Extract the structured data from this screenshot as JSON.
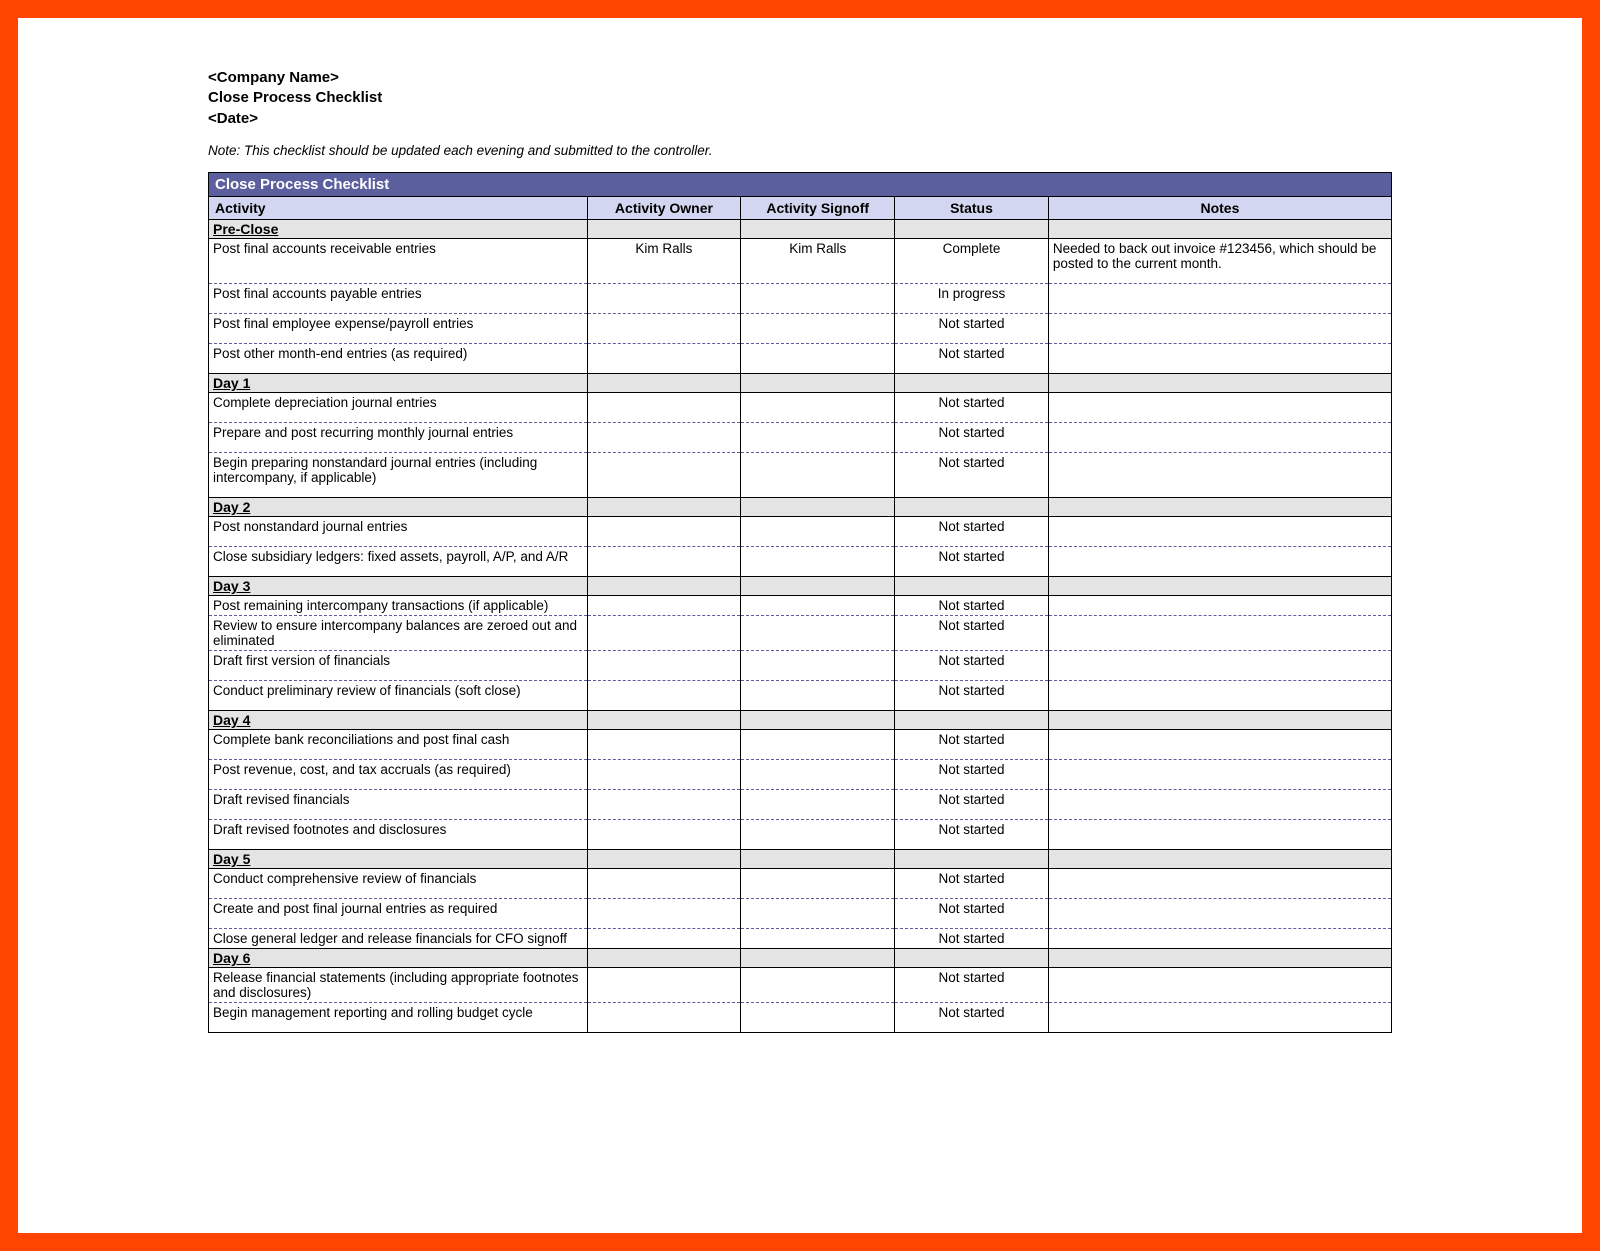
{
  "header": {
    "company": "<Company Name>",
    "title": "Close Process Checklist",
    "date": "<Date>"
  },
  "note": "Note: This checklist should be updated each evening and submitted to the controller.",
  "table": {
    "title": "Close Process Checklist",
    "columns": {
      "activity": "Activity",
      "owner": "Activity Owner",
      "signoff": "Activity Signoff",
      "status": "Status",
      "notes": "Notes"
    },
    "sections": [
      {
        "name": "Pre-Close",
        "rows": [
          {
            "activity": "Post final accounts receivable entries",
            "owner": "Kim Ralls",
            "signoff": "Kim Ralls",
            "status": "Complete",
            "notes": "Needed to back out invoice #123456, which should be posted to the current month."
          },
          {
            "activity": "Post final accounts payable entries",
            "owner": "",
            "signoff": "",
            "status": "In progress",
            "notes": ""
          },
          {
            "activity": "Post final employee expense/payroll entries",
            "owner": "",
            "signoff": "",
            "status": "Not started",
            "notes": ""
          },
          {
            "activity": "Post other month-end entries (as required)",
            "owner": "",
            "signoff": "",
            "status": "Not started",
            "notes": ""
          }
        ]
      },
      {
        "name": "Day 1",
        "rows": [
          {
            "activity": "Complete depreciation journal entries",
            "owner": "",
            "signoff": "",
            "status": "Not started",
            "notes": ""
          },
          {
            "activity": "Prepare and post recurring monthly journal entries",
            "owner": "",
            "signoff": "",
            "status": "Not started",
            "notes": ""
          },
          {
            "activity": "Begin preparing nonstandard journal entries (including intercompany, if applicable)",
            "owner": "",
            "signoff": "",
            "status": "Not started",
            "notes": ""
          }
        ]
      },
      {
        "name": "Day 2",
        "rows": [
          {
            "activity": "Post nonstandard journal entries",
            "owner": "",
            "signoff": "",
            "status": "Not started",
            "notes": ""
          },
          {
            "activity": "Close subsidiary ledgers: fixed assets, payroll, A/P, and A/R",
            "owner": "",
            "signoff": "",
            "status": "Not started",
            "notes": ""
          }
        ]
      },
      {
        "name": "Day 3",
        "rows": [
          {
            "activity": "Post remaining intercompany transactions (if applicable)",
            "owner": "",
            "signoff": "",
            "status": "Not started",
            "notes": "",
            "tight": true
          },
          {
            "activity": "Review to ensure intercompany balances are zeroed out and eliminated",
            "owner": "",
            "signoff": "",
            "status": "Not started",
            "notes": "",
            "tight": true
          },
          {
            "activity": "Draft first version of financials",
            "owner": "",
            "signoff": "",
            "status": "Not started",
            "notes": ""
          },
          {
            "activity": "Conduct preliminary review of financials (soft close)",
            "owner": "",
            "signoff": "",
            "status": "Not started",
            "notes": ""
          }
        ]
      },
      {
        "name": "Day 4",
        "rows": [
          {
            "activity": "Complete bank reconciliations and post final cash",
            "owner": "",
            "signoff": "",
            "status": "Not started",
            "notes": ""
          },
          {
            "activity": "Post revenue, cost, and tax accruals (as required)",
            "owner": "",
            "signoff": "",
            "status": "Not started",
            "notes": ""
          },
          {
            "activity": "Draft revised financials",
            "owner": "",
            "signoff": "",
            "status": "Not started",
            "notes": ""
          },
          {
            "activity": "Draft revised footnotes and disclosures",
            "owner": "",
            "signoff": "",
            "status": "Not started",
            "notes": ""
          }
        ]
      },
      {
        "name": "Day 5",
        "rows": [
          {
            "activity": "Conduct comprehensive review of financials",
            "owner": "",
            "signoff": "",
            "status": "Not started",
            "notes": ""
          },
          {
            "activity": "Create and post final journal entries as required",
            "owner": "",
            "signoff": "",
            "status": "Not started",
            "notes": ""
          },
          {
            "activity": "Close general ledger and release financials for CFO signoff",
            "owner": "",
            "signoff": "",
            "status": "Not started",
            "notes": "",
            "tight": true
          }
        ]
      },
      {
        "name": "Day 6",
        "rows": [
          {
            "activity": "Release financial statements (including appropriate footnotes and disclosures)",
            "owner": "",
            "signoff": "",
            "status": "Not started",
            "notes": "",
            "tight": true
          },
          {
            "activity": "Begin management reporting and rolling budget cycle",
            "owner": "",
            "signoff": "",
            "status": "Not started",
            "notes": ""
          }
        ]
      }
    ]
  }
}
